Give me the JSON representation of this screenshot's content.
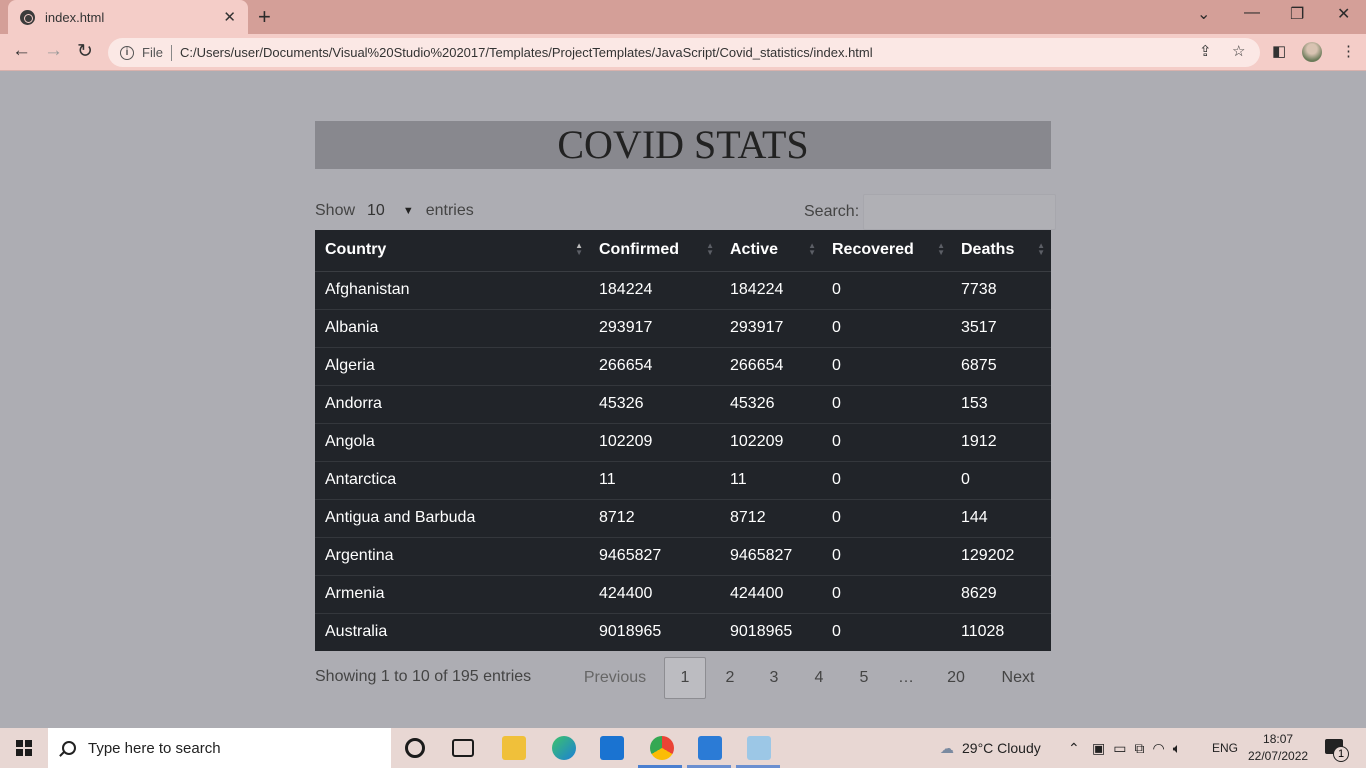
{
  "browser": {
    "tab_title": "index.html",
    "protocol_label": "File",
    "url": "C:/Users/user/Documents/Visual%20Studio%202017/Templates/ProjectTemplates/JavaScript/Covid_statistics/index.html"
  },
  "page": {
    "heading": "COVID STATS",
    "show_label": "Show",
    "entries_label": "entries",
    "page_length": "10",
    "search_label": "Search:",
    "search_value": "",
    "columns": [
      "Country",
      "Confirmed",
      "Active",
      "Recovered",
      "Deaths"
    ],
    "rows": [
      [
        "Afghanistan",
        "184224",
        "184224",
        "0",
        "7738"
      ],
      [
        "Albania",
        "293917",
        "293917",
        "0",
        "3517"
      ],
      [
        "Algeria",
        "266654",
        "266654",
        "0",
        "6875"
      ],
      [
        "Andorra",
        "45326",
        "45326",
        "0",
        "153"
      ],
      [
        "Angola",
        "102209",
        "102209",
        "0",
        "1912"
      ],
      [
        "Antarctica",
        "11",
        "11",
        "0",
        "0"
      ],
      [
        "Antigua and Barbuda",
        "8712",
        "8712",
        "0",
        "144"
      ],
      [
        "Argentina",
        "9465827",
        "9465827",
        "0",
        "129202"
      ],
      [
        "Armenia",
        "424400",
        "424400",
        "0",
        "8629"
      ],
      [
        "Australia",
        "9018965",
        "9018965",
        "0",
        "11028"
      ]
    ],
    "info": "Showing 1 to 10 of 195 entries",
    "pagination": {
      "previous": "Previous",
      "pages": [
        "1",
        "2",
        "3",
        "4",
        "5",
        "…",
        "20"
      ],
      "current": "1",
      "next": "Next"
    }
  },
  "taskbar": {
    "search_placeholder": "Type here to search",
    "weather": "29°C  Cloudy",
    "language": "ENG",
    "time": "18:07",
    "date": "22/07/2022",
    "notification_count": "1"
  },
  "colors": {
    "page_bg": "#adadb3",
    "table_bg": "#212429",
    "heading_bg": "#88888e",
    "chrome_tab": "#f4cdc8"
  }
}
